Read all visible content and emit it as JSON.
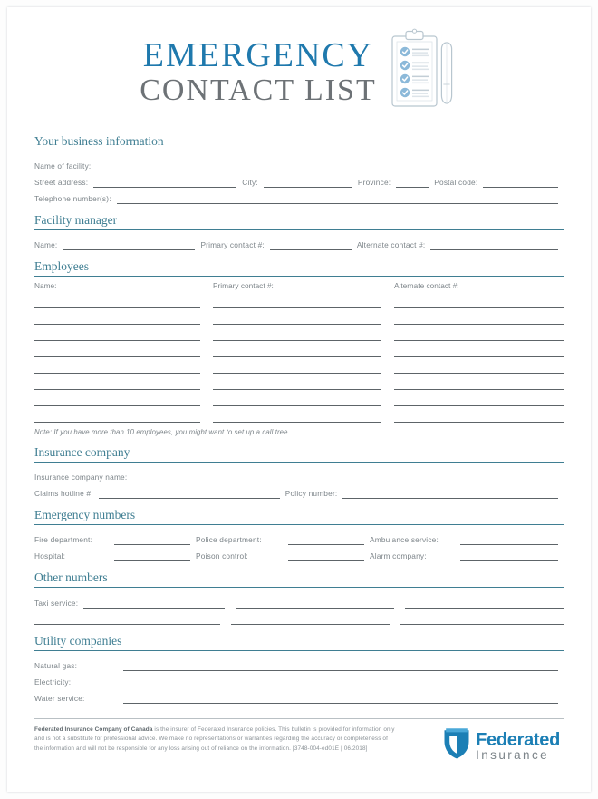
{
  "header": {
    "title_line1": "EMERGENCY",
    "title_line2": "CONTACT LIST",
    "clipboard_icon": "clipboard-checklist-icon",
    "pen_icon": "pen-icon",
    "accent_blue": "#1f79ad",
    "title_gray": "#6d7276"
  },
  "colors": {
    "section_heading": "#3f7e92",
    "label_gray": "#7c8489",
    "rule_dark": "#5d6468",
    "logo_blue": "#1c7fb5"
  },
  "sections": {
    "business": {
      "heading": "Your business information",
      "labels": {
        "facility_name": "Name of facility:",
        "street_address": "Street address:",
        "city": "City:",
        "province": "Province:",
        "postal_code": "Postal code:",
        "telephone": "Telephone number(s):"
      },
      "values": {
        "facility_name": "",
        "street_address": "",
        "city": "",
        "province": "",
        "postal_code": "",
        "telephone": ""
      }
    },
    "facility_manager": {
      "heading": "Facility manager",
      "labels": {
        "name": "Name:",
        "primary": "Primary contact #:",
        "alternate": "Alternate contact #:"
      },
      "values": {
        "name": "",
        "primary": "",
        "alternate": ""
      }
    },
    "employees": {
      "heading": "Employees",
      "columns": [
        "Name:",
        "Primary contact #:",
        "Alternate contact #:"
      ],
      "rows": [
        {
          "name": "",
          "primary": "",
          "alternate": ""
        },
        {
          "name": "",
          "primary": "",
          "alternate": ""
        },
        {
          "name": "",
          "primary": "",
          "alternate": ""
        },
        {
          "name": "",
          "primary": "",
          "alternate": ""
        },
        {
          "name": "",
          "primary": "",
          "alternate": ""
        },
        {
          "name": "",
          "primary": "",
          "alternate": ""
        },
        {
          "name": "",
          "primary": "",
          "alternate": ""
        },
        {
          "name": "",
          "primary": "",
          "alternate": ""
        }
      ],
      "note": "Note: If you have more than 10 employees, you might want to set up a call tree."
    },
    "insurance": {
      "heading": "Insurance company",
      "labels": {
        "company_name": "Insurance company name:",
        "claims_hotline": "Claims hotline #:",
        "policy_number": "Policy number:"
      },
      "values": {
        "company_name": "",
        "claims_hotline": "",
        "policy_number": ""
      }
    },
    "emergency_numbers": {
      "heading": "Emergency numbers",
      "labels": {
        "fire": "Fire department:",
        "police": "Police department:",
        "ambulance": "Ambulance service:",
        "hospital": "Hospital:",
        "poison": "Poison control:",
        "alarm": "Alarm company:"
      },
      "values": {
        "fire": "",
        "police": "",
        "ambulance": "",
        "hospital": "",
        "poison": "",
        "alarm": ""
      }
    },
    "other_numbers": {
      "heading": "Other numbers",
      "labels": {
        "taxi": "Taxi service:"
      },
      "row1": [
        "",
        "",
        ""
      ],
      "row2": [
        "",
        "",
        ""
      ]
    },
    "utilities": {
      "heading": "Utility companies",
      "labels": {
        "natural_gas": "Natural gas:",
        "electricity": "Electricity:",
        "water": "Water service:"
      },
      "values": {
        "natural_gas": "",
        "electricity": "",
        "water": ""
      }
    }
  },
  "footer": {
    "disclaimer_bold": "Federated Insurance Company of Canada",
    "disclaimer_rest": " is the insurer of Federated Insurance policies. This bulletin is provided for information only and is not a substitute for professional advice. We make no representations or warranties regarding the accuracy or completeness of the information and will not be responsible for any loss arising out of reliance on the information. [3748-004-ed01E | 06.2018]",
    "logo_primary": "Federated",
    "logo_secondary": "Insurance",
    "logo_mark": "shield-icon"
  }
}
